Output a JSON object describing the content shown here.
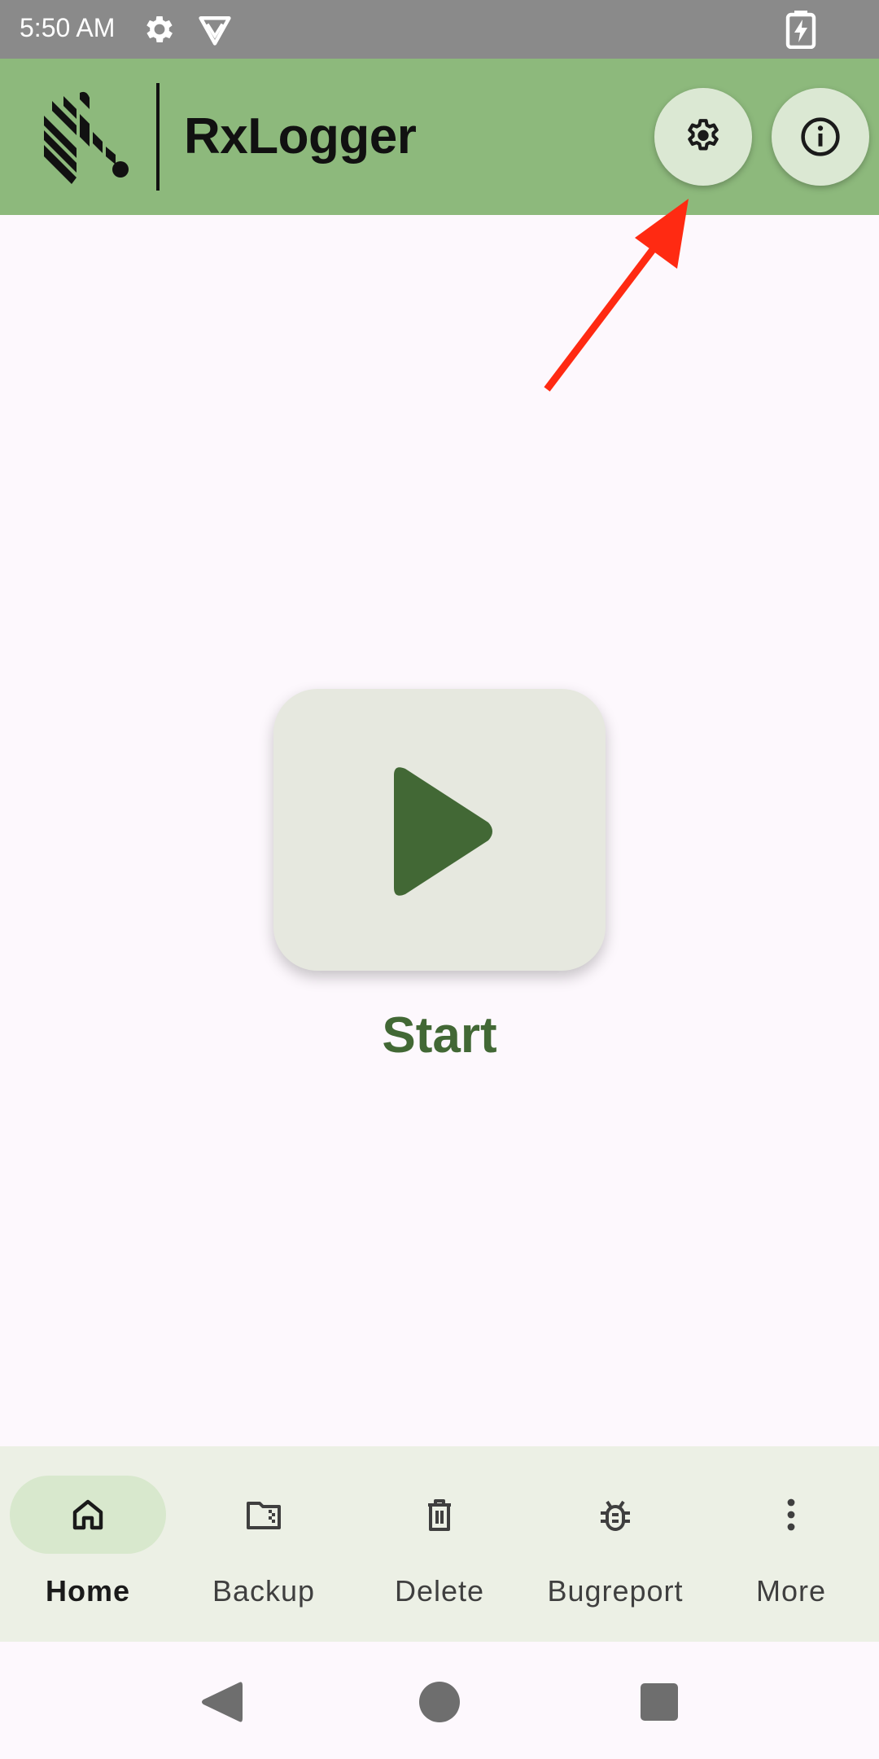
{
  "status_bar": {
    "time": "5:50 AM",
    "icons": [
      "gear-icon",
      "vpn-icon",
      "battery-charging-icon"
    ]
  },
  "app_bar": {
    "title": "RxLogger",
    "logo": "zebra-logo",
    "actions": [
      {
        "name": "settings",
        "icon": "gear-icon"
      },
      {
        "name": "info",
        "icon": "info-icon"
      }
    ]
  },
  "annotation": {
    "type": "arrow",
    "color": "#ff2a12",
    "points_to": "settings-button"
  },
  "main": {
    "start_label": "Start",
    "start_icon": "play-icon"
  },
  "bottom_nav": {
    "items": [
      {
        "label": "Home",
        "icon": "home-icon",
        "active": true
      },
      {
        "label": "Backup",
        "icon": "folder-zip-icon",
        "active": false
      },
      {
        "label": "Delete",
        "icon": "trash-icon",
        "active": false
      },
      {
        "label": "Bugreport",
        "icon": "bug-icon",
        "active": false
      },
      {
        "label": "More",
        "icon": "more-vertical-icon",
        "active": false
      }
    ]
  },
  "system_nav": {
    "buttons": [
      "back-icon",
      "home-circle-icon",
      "recents-icon"
    ]
  },
  "colors": {
    "app_bar": "#8db97c",
    "accent_green": "#426835",
    "background": "#fdf8fd",
    "nav_background": "#ecf0e5",
    "active_pill": "#d8e8cd",
    "status_bar": "#8a8a8a"
  }
}
